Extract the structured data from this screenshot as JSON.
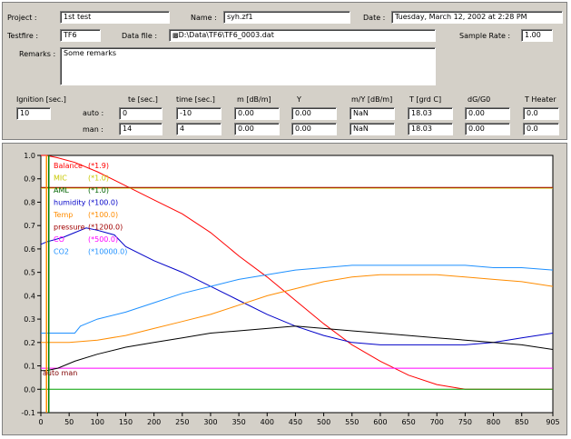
{
  "form": {
    "project_label": "Project :",
    "project_value": "1st test",
    "name_label": "Name :",
    "name_value": "syh.zf1",
    "date_label": "Date :",
    "date_value": "Tuesday, March 12, 2002 at 2:28 PM",
    "testfire_label": "Testfire :",
    "testfire_value": "TF6",
    "datafile_label": "Data file :",
    "datafile_value": "D:\\Data\\TF6\\TF6_0003.dat",
    "samplerate_label": "Sample Rate :",
    "samplerate_value": "1.00",
    "remarks_label": "Remarks :",
    "remarks_value": "Some remarks",
    "ignition_label": "Ignition [sec.]",
    "ignition_value": "10",
    "auto_label": "auto :",
    "man_label": "man :",
    "columns": [
      "te [sec.]",
      "time [sec.]",
      "m [dB/m]",
      "Y",
      "m/Y [dB/m]",
      "T [grd C]",
      "dG/G0",
      "T Heater"
    ],
    "auto_values": [
      "0",
      "-10",
      "0.00",
      "0.00",
      "NaN",
      "18.03",
      "0.00",
      "0.0"
    ],
    "man_values": [
      "14",
      "4",
      "0.00",
      "0.00",
      "NaN",
      "18.03",
      "0.00",
      "0.0"
    ]
  },
  "chart_data": {
    "type": "line",
    "xlim": [
      0,
      905
    ],
    "ylim": [
      -0.1,
      1.0
    ],
    "x_ticks": [
      0,
      50,
      100,
      150,
      200,
      250,
      300,
      350,
      400,
      450,
      500,
      550,
      600,
      650,
      700,
      750,
      800,
      850,
      905
    ],
    "y_ticks": [
      "1.0",
      "0.9",
      "0.8",
      "0.7",
      "0.6",
      "0.5",
      "0.4",
      "0.3",
      "0.2",
      "0.1",
      "0.0",
      "-0.1"
    ],
    "y_tick_values": [
      1.0,
      0.9,
      0.8,
      0.7,
      0.6,
      0.5,
      0.4,
      0.3,
      0.2,
      0.1,
      0.0,
      -0.1
    ],
    "grid": false,
    "legend_placement": "top-left",
    "marker_lines": {
      "x": [
        10,
        14
      ],
      "colors": [
        "#ff8c00",
        "#008000"
      ]
    },
    "annotation": "auto man",
    "legend": [
      {
        "name": "Balance",
        "scale": "(*1.9)",
        "color": "#ff0000"
      },
      {
        "name": "MIC",
        "scale": "(*1.0)",
        "color": "#c8c800"
      },
      {
        "name": "AML",
        "scale": "(*1.0)",
        "color": "#006400"
      },
      {
        "name": "humidity",
        "scale": "(*100.0)",
        "color": "#0000c8"
      },
      {
        "name": "Temp",
        "scale": "(*100.0)",
        "color": "#ff8c00"
      },
      {
        "name": "pressure",
        "scale": "(*1200.0)",
        "color": "#a00000"
      },
      {
        "name": "CO",
        "scale": "(*500.0)",
        "color": "#ff00ff"
      },
      {
        "name": "CO2",
        "scale": "(*10000.0)",
        "color": "#1e90ff"
      }
    ],
    "series": [
      {
        "name": "Balance",
        "color": "#ff0000",
        "x": [
          0,
          10,
          30,
          60,
          100,
          150,
          200,
          250,
          300,
          350,
          400,
          450,
          500,
          550,
          600,
          650,
          700,
          750,
          800,
          850,
          905
        ],
        "y": [
          1.0,
          1.0,
          0.99,
          0.97,
          0.93,
          0.87,
          0.81,
          0.75,
          0.67,
          0.57,
          0.48,
          0.38,
          0.28,
          0.19,
          0.12,
          0.06,
          0.02,
          0.0,
          0.0,
          0.0,
          0.0
        ]
      },
      {
        "name": "MIC",
        "color": "#c8c800",
        "x": [
          0,
          905
        ],
        "y": [
          0.86,
          0.86
        ]
      },
      {
        "name": "pressure",
        "color": "#a00000",
        "x": [
          0,
          905
        ],
        "y": [
          0.863,
          0.863
        ]
      },
      {
        "name": "AML",
        "color": "#00a000",
        "x": [
          0,
          905
        ],
        "y": [
          0.0,
          0.0
        ]
      },
      {
        "name": "humidity",
        "color": "#0000c8",
        "x": [
          0,
          10,
          40,
          60,
          80,
          100,
          130,
          150,
          200,
          250,
          300,
          350,
          400,
          450,
          500,
          550,
          600,
          650,
          700,
          750,
          800,
          850,
          905
        ],
        "y": [
          0.62,
          0.63,
          0.65,
          0.67,
          0.69,
          0.68,
          0.66,
          0.61,
          0.55,
          0.5,
          0.44,
          0.38,
          0.32,
          0.27,
          0.23,
          0.2,
          0.19,
          0.19,
          0.19,
          0.19,
          0.2,
          0.22,
          0.24
        ]
      },
      {
        "name": "Temp",
        "color": "#ff8c00",
        "x": [
          0,
          50,
          100,
          150,
          200,
          250,
          300,
          350,
          400,
          450,
          500,
          550,
          600,
          650,
          700,
          750,
          800,
          850,
          905
        ],
        "y": [
          0.2,
          0.2,
          0.21,
          0.23,
          0.26,
          0.29,
          0.32,
          0.36,
          0.4,
          0.43,
          0.46,
          0.48,
          0.49,
          0.49,
          0.49,
          0.48,
          0.47,
          0.46,
          0.44
        ]
      },
      {
        "name": "CO",
        "color": "#ff00ff",
        "x": [
          0,
          905
        ],
        "y": [
          0.09,
          0.09
        ]
      },
      {
        "name": "CO2",
        "color": "#1e90ff",
        "x": [
          0,
          10,
          60,
          70,
          80,
          100,
          150,
          200,
          250,
          300,
          350,
          400,
          450,
          500,
          550,
          600,
          650,
          700,
          750,
          800,
          850,
          905
        ],
        "y": [
          0.24,
          0.24,
          0.24,
          0.27,
          0.28,
          0.3,
          0.33,
          0.37,
          0.41,
          0.44,
          0.47,
          0.49,
          0.51,
          0.52,
          0.53,
          0.53,
          0.53,
          0.53,
          0.53,
          0.52,
          0.52,
          0.51
        ]
      },
      {
        "name": "unlabeled",
        "color": "#000000",
        "x": [
          0,
          10,
          30,
          60,
          100,
          150,
          200,
          250,
          300,
          350,
          400,
          450,
          500,
          550,
          600,
          650,
          700,
          750,
          800,
          850,
          905
        ],
        "y": [
          0.08,
          0.08,
          0.09,
          0.12,
          0.15,
          0.18,
          0.2,
          0.22,
          0.24,
          0.25,
          0.26,
          0.27,
          0.26,
          0.25,
          0.24,
          0.23,
          0.22,
          0.21,
          0.2,
          0.19,
          0.17
        ]
      }
    ]
  }
}
